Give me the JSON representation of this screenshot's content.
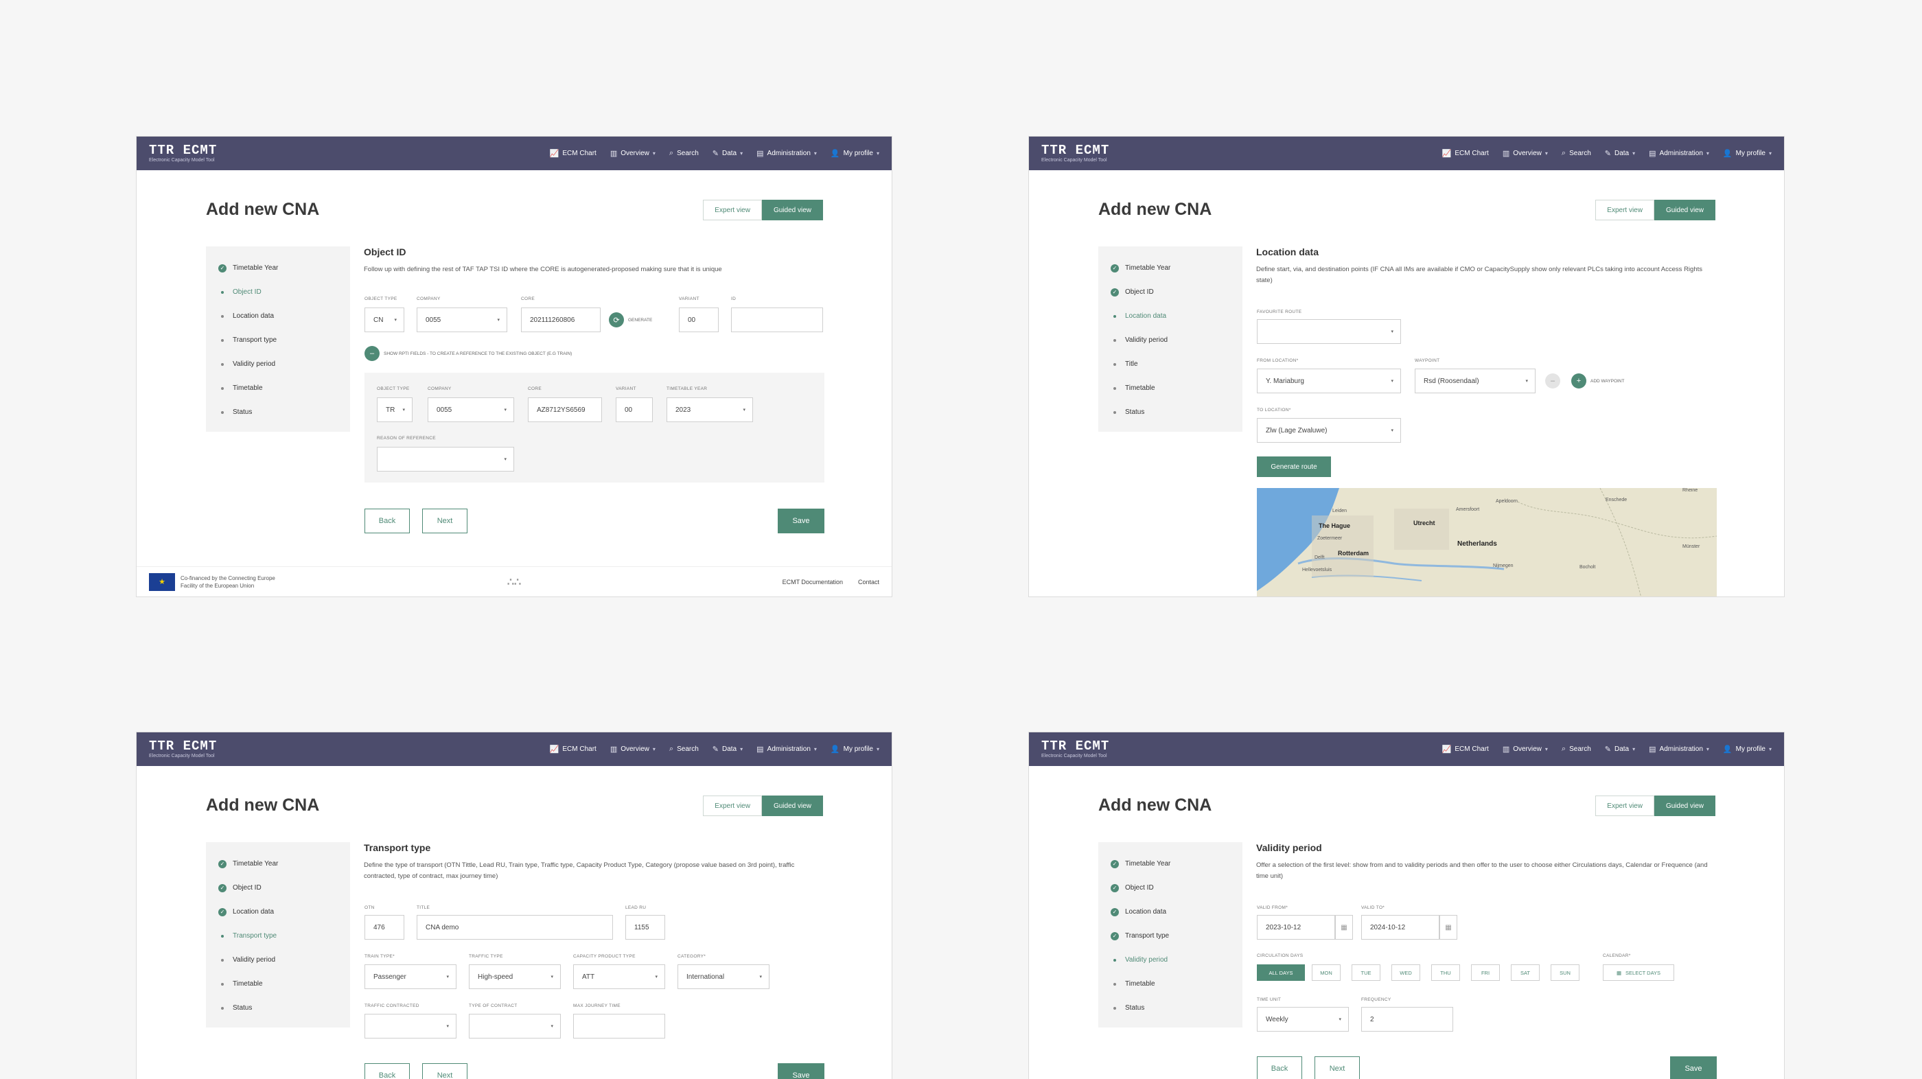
{
  "nav": {
    "logo": "TTR ECMT",
    "logo_sub": "Electronic Capacity Model Tool",
    "items": [
      "ECM Chart",
      "Overview",
      "Search",
      "Data",
      "Administration",
      "My profile"
    ]
  },
  "page_title": "Add new CNA",
  "views": {
    "expert": "Expert view",
    "guided": "Guided view"
  },
  "steps_a": [
    "Timetable Year",
    "Object ID",
    "Location data",
    "Transport type",
    "Validity period",
    "Timetable",
    "Status"
  ],
  "steps_b": [
    "Timetable Year",
    "Object ID",
    "Location data",
    "Validity period",
    "Title",
    "Timetable",
    "Status"
  ],
  "buttons": {
    "back": "Back",
    "next": "Next",
    "save": "Save"
  },
  "panel1": {
    "title": "Object ID",
    "desc": "Follow up with defining the rest of TAF TAP TSI ID where the CORE is autogenerated-proposed making sure that it is unique",
    "labels": {
      "object_type": "OBJECT TYPE",
      "company": "COMPANY",
      "core": "CORE",
      "variant": "VARIANT",
      "id": "ID",
      "timetable_year": "TIMETABLE YEAR",
      "reason": "REASON OF REFERENCE"
    },
    "object_type": "CN",
    "company": "0055",
    "core": "202111260806",
    "generate": "GENERATE",
    "variant": "00",
    "id": "",
    "show_rpti": "SHOW RPTI FIELDS - TO CREATE A REFERENCE TO THE EXISTING OBJECT (E.G TRAIN)",
    "ref_object_type": "TR",
    "ref_company": "0055",
    "ref_core": "AZ8712YS6569",
    "ref_variant": "00",
    "ref_timetable_year": "2023",
    "ref_reason": ""
  },
  "footer": {
    "eu_text_1": "Co-financed by the Connecting Europe",
    "eu_text_2": "Facility of the European Union",
    "mid": "∴∴",
    "docs": "ECMT Documentation",
    "contact": "Contact"
  },
  "panel2": {
    "title": "Location data",
    "desc": "Define start, via, and destination points (IF CNA all IMs are available if CMO or CapacitySupply show only relevant PLCs taking into account Access Rights state)",
    "labels": {
      "favourite": "FAVOURITE ROUTE",
      "from": "FROM LOCATION*",
      "waypoint": "WAYPOINT",
      "to": "TO LOCATION*"
    },
    "favourite": "",
    "from": "Y. Mariaburg",
    "waypoint": "Rsd (Roosendaal)",
    "add_waypoint": "ADD WAYPOINT",
    "to": "Zlw (Lage Zwaluwe)",
    "generate_route": "Generate route",
    "map_cities": [
      "The Hague",
      "Utrecht",
      "Netherlands",
      "Rotterdam",
      "Amersfoort",
      "Apeldoorn",
      "Enschede",
      "Münster",
      "Bocholt",
      "Nijmegen",
      "Leiden",
      "Zoetermeer",
      "Delft",
      "Hellevoetsluis",
      "Rheine"
    ]
  },
  "panel3": {
    "title": "Transport type",
    "desc": "Define the type of transport (OTN Tittle, Lead RU, Train type, Traffic type, Capacity Product Type, Category (propose value based on 3rd point), traffic contracted, type of contract, max journey time)",
    "labels": {
      "otn": "OTN",
      "title": "TITLE",
      "lead_ru": "LEAD RU",
      "train_type": "TRAIN TYPE*",
      "traffic_type": "TRAFFIC TYPE",
      "capacity": "CAPACITY PRODUCT TYPE",
      "category": "CATEGORY*",
      "traffic_contracted": "TRAFFIC CONTRACTED",
      "type_contract": "TYPE OF CONTRACT",
      "max_journey": "MAX JOURNEY TIME"
    },
    "otn": "476",
    "title_val": "CNA demo",
    "lead_ru": "1155",
    "train_type": "Passenger",
    "traffic_type": "High-speed",
    "capacity": "ATT",
    "category": "International"
  },
  "panel4": {
    "title": "Validity period",
    "desc": "Offer a selection of the first level: show from and to validity periods and then offer to the user to choose either Circulations days, Calendar or Frequence (and time unit)",
    "labels": {
      "valid_from": "VALID FROM*",
      "valid_to": "VALID TO*",
      "circulation": "CIRCULATION DAYS",
      "calendar": "CALENDAR*",
      "time_unit": "TIME UNIT",
      "frequency": "FREQUENCY"
    },
    "valid_from": "2023-10-12",
    "valid_to": "2024-10-12",
    "days": [
      "ALL DAYS",
      "MON",
      "TUE",
      "WED",
      "THU",
      "FRI",
      "SAT",
      "SUN"
    ],
    "select_days": "SELECT DAYS",
    "time_unit": "Weekly",
    "frequency": "2"
  },
  "colors": {
    "nav": "#4c4c6c",
    "accent": "#4f8a76"
  }
}
